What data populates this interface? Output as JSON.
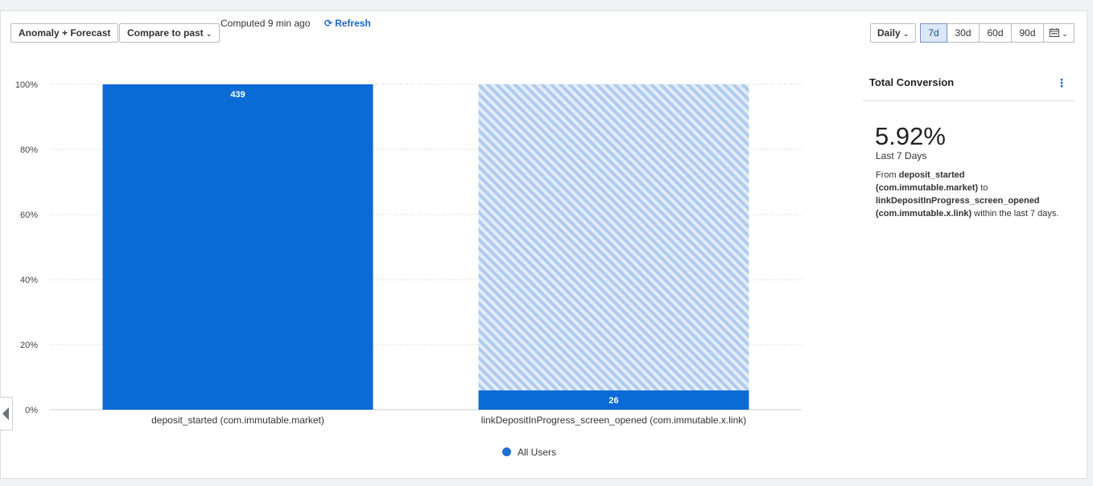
{
  "toolbar": {
    "anomaly_label": "Anomaly + Forecast",
    "compare_label": "Compare to past",
    "computed_text": "Computed 9 min ago",
    "refresh_label": "Refresh",
    "interval_label": "Daily",
    "ranges": [
      "7d",
      "30d",
      "60d",
      "90d"
    ],
    "active_range": "7d"
  },
  "colors": {
    "bar": "#0a6bd6",
    "bar_dropoff_stripe": "#b7d1f1",
    "accent": "#1a67c9"
  },
  "chart_data": {
    "type": "bar",
    "categories": [
      "deposit_started (com.immutable.market)",
      "linkDepositInProgress_screen_opened (com.immutable.x.link)"
    ],
    "series": [
      {
        "name": "All Users",
        "values": [
          100,
          5.92
        ],
        "counts": [
          "439",
          "26"
        ]
      }
    ],
    "yticks": [
      "0%",
      "20%",
      "40%",
      "60%",
      "80%",
      "100%"
    ],
    "ylim": [
      0,
      100
    ],
    "grid": true,
    "legend": "bottom-center"
  },
  "sidebar": {
    "title": "Total Conversion",
    "value": "5.92%",
    "period": "Last 7 Days",
    "desc_from": "From ",
    "desc_event1": "deposit_started (com.immutable.market)",
    "desc_to": " to ",
    "desc_event2": "linkDepositInProgress_screen_opened (com.immutable.x.link)",
    "desc_tail": " within the last 7 days."
  }
}
